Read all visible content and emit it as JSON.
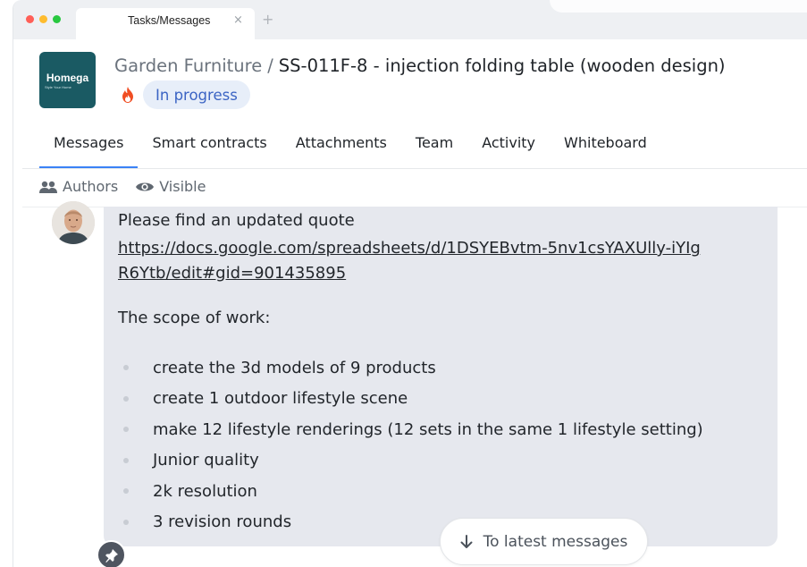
{
  "browser": {
    "tab_title": "Tasks/Messages",
    "tab_close": "×",
    "new_tab": "+",
    "traffic_lights": [
      "#ff5f57",
      "#febc2e",
      "#28c840"
    ]
  },
  "header": {
    "logo_text": "Homega",
    "logo_tagline": "Style Your Home",
    "breadcrumb_parent": "Garden Furniture",
    "breadcrumb_separator": "/",
    "breadcrumb_current": "SS-011F-8 - injection folding table (wooden design)",
    "status": "In progress",
    "status_icon": "fire-icon"
  },
  "tabs": [
    {
      "label": "Messages",
      "active": true
    },
    {
      "label": "Smart contracts",
      "active": false
    },
    {
      "label": "Attachments",
      "active": false
    },
    {
      "label": "Team",
      "active": false
    },
    {
      "label": "Activity",
      "active": false
    },
    {
      "label": "Whiteboard",
      "active": false
    }
  ],
  "filters": {
    "authors": "Authors",
    "visible": "Visible"
  },
  "message": {
    "intro": "Please find an updated quote",
    "link": "https://docs.google.com/spreadsheets/d/1DSYEBvtm-5nv1csYAXUlly-iYIgR6Ytb/edit#gid=901435895",
    "scope_heading": "The scope of work:",
    "items": [
      "create the 3d models of 9 products",
      "create 1 outdoor lifestyle scene",
      "make 12 lifestyle renderings (12 sets in the same 1 lifestyle setting)",
      "Junior quality",
      "2k resolution",
      "3 revision rounds"
    ]
  },
  "latest_button": "To latest messages",
  "colors": {
    "accent": "#3b82f6",
    "status_bg": "#e7eef9",
    "status_text": "#3b64c4",
    "logo_bg": "#1a5a63",
    "bubble_bg": "#e6e8ee"
  }
}
